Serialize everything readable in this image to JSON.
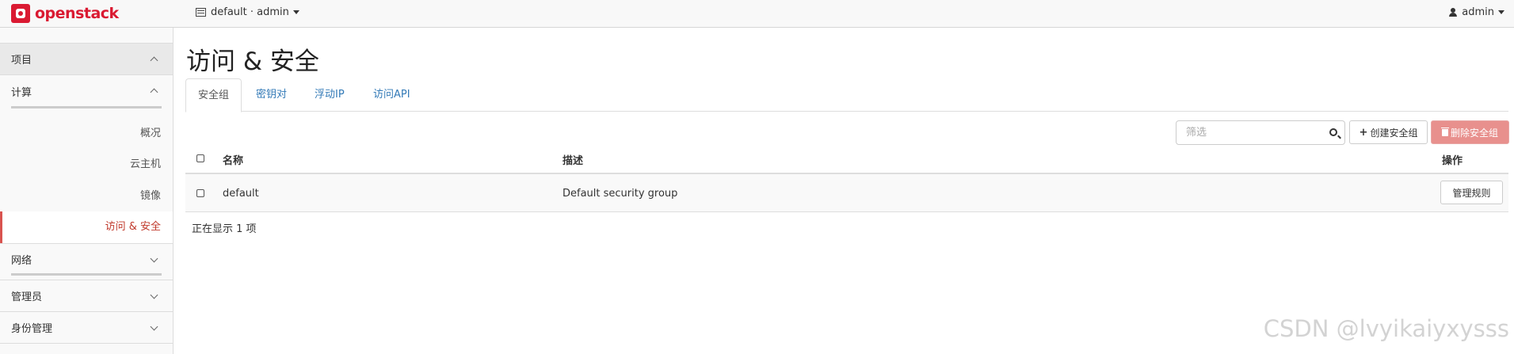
{
  "brand": {
    "name": "openstack"
  },
  "topbar": {
    "project_picker": "default · admin",
    "user": "admin"
  },
  "sidebar": {
    "groups": [
      {
        "label": "项目",
        "state": "expanded"
      },
      {
        "label": "计算",
        "state": "expanded"
      },
      {
        "label": "网络",
        "state": "collapsed"
      },
      {
        "label": "管理员",
        "state": "collapsed"
      },
      {
        "label": "身份管理",
        "state": "collapsed"
      }
    ],
    "items": [
      {
        "label": "概况"
      },
      {
        "label": "云主机"
      },
      {
        "label": "镜像"
      },
      {
        "label": "访问 & 安全",
        "active": true
      }
    ]
  },
  "main": {
    "title": "访问 & 安全",
    "tabs": [
      {
        "label": "安全组",
        "active": true
      },
      {
        "label": "密钥对"
      },
      {
        "label": "浮动IP"
      },
      {
        "label": "访问API"
      }
    ],
    "filter_placeholder": "筛选",
    "create_button": "创建安全组",
    "delete_button": "删除安全组",
    "table": {
      "columns": [
        "名称",
        "描述",
        "操作"
      ],
      "rows": [
        {
          "name": "default",
          "description": "Default security group",
          "action": "管理规则"
        }
      ]
    },
    "footer": "正在显示 1 项"
  },
  "watermark": "CSDN @lvyikaiyxysss",
  "colors": {
    "brand": "#da1a32",
    "link": "#337ab7",
    "active": "#c0392b",
    "danger_disabled": "#e8908d"
  }
}
